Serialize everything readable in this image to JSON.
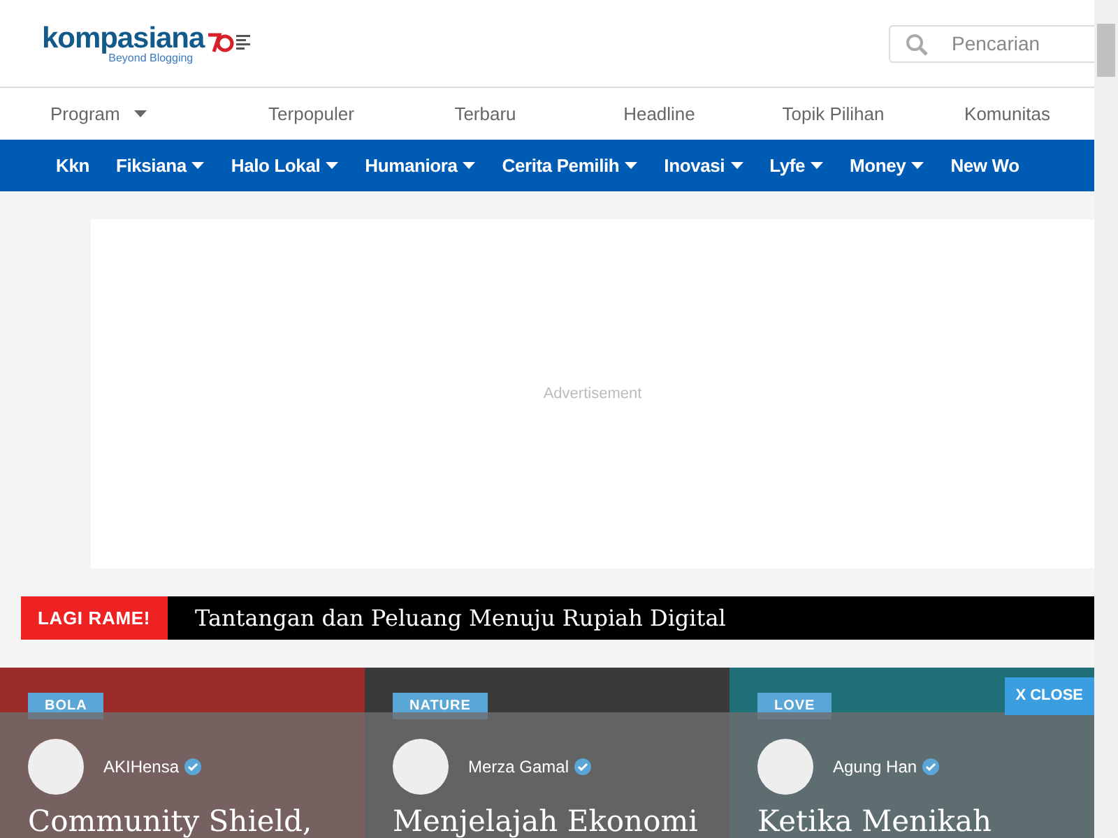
{
  "header": {
    "logo": {
      "name": "kompasiana",
      "tagline": "Beyond Blogging"
    },
    "search": {
      "placeholder": "Pencarian"
    }
  },
  "top_nav": [
    {
      "label": "Program",
      "caret": true
    },
    {
      "label": "Terpopuler",
      "caret": false
    },
    {
      "label": "Terbaru",
      "caret": false
    },
    {
      "label": "Headline",
      "caret": false
    },
    {
      "label": "Topik Pilihan",
      "caret": false
    },
    {
      "label": "Komunitas",
      "caret": false
    }
  ],
  "category_nav": [
    {
      "label": "Kkn",
      "caret": false
    },
    {
      "label": "Fiksiana",
      "caret": true
    },
    {
      "label": "Halo Lokal",
      "caret": true
    },
    {
      "label": "Humaniora",
      "caret": true
    },
    {
      "label": "Cerita Pemilih",
      "caret": true
    },
    {
      "label": "Inovasi",
      "caret": true
    },
    {
      "label": "Lyfe",
      "caret": true
    },
    {
      "label": "Money",
      "caret": true
    },
    {
      "label": "New Wo",
      "caret": false
    }
  ],
  "advertisement": {
    "label": "Advertisement"
  },
  "ticker": {
    "badge": "LAGI RAME!",
    "headline": "Tantangan dan Peluang Menuju Rupiah Digital"
  },
  "cards": [
    {
      "category": "BOLA",
      "author": "AKIHensa",
      "verified": true,
      "title": "Community Shield,",
      "color": "#9b2a2a"
    },
    {
      "category": "NATURE",
      "author": "Merza Gamal",
      "verified": true,
      "title": "Menjelajah Ekonomi",
      "color": "#3a3a3a"
    },
    {
      "category": "LOVE",
      "author": "Agung Han",
      "verified": true,
      "title": "Ketika Menikah",
      "color": "#1f6f78"
    }
  ],
  "overlay": {
    "close_label": "X CLOSE"
  }
}
